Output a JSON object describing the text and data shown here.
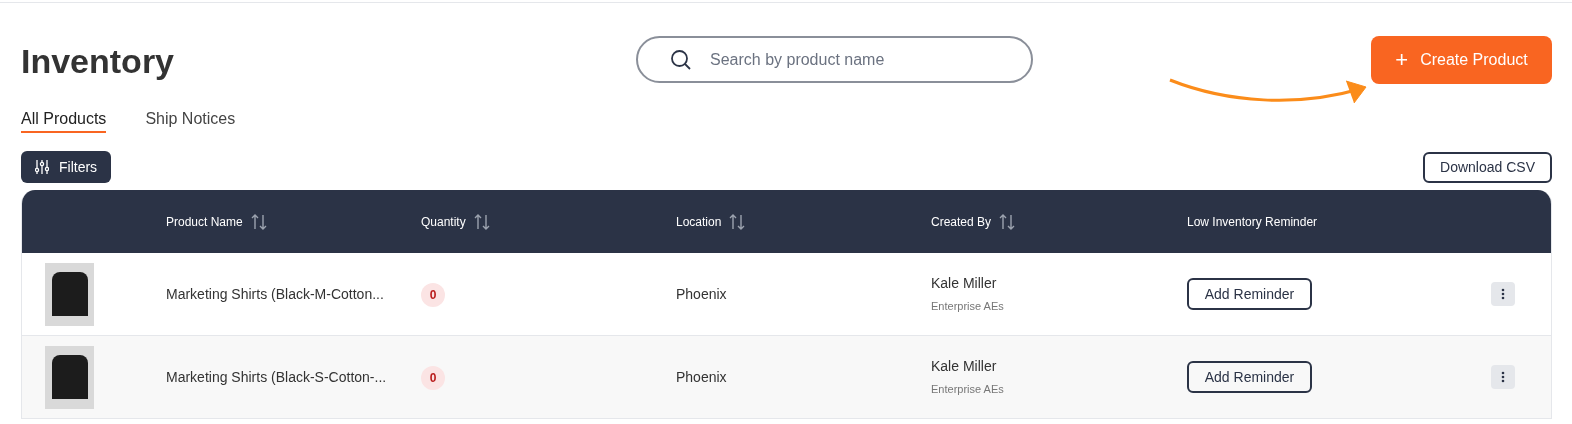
{
  "page_title": "Inventory",
  "search": {
    "placeholder": "Search by product name"
  },
  "create_button": {
    "label": "Create Product",
    "icon": "+"
  },
  "tabs": [
    {
      "label": "All Products",
      "selected": true
    },
    {
      "label": "Ship Notices",
      "selected": false
    }
  ],
  "filters_button": {
    "label": "Filters"
  },
  "download_button": {
    "label": "Download CSV"
  },
  "table": {
    "columns": [
      {
        "label": "Product Name",
        "sortable": true
      },
      {
        "label": "Quantity",
        "sortable": true
      },
      {
        "label": "Location",
        "sortable": true
      },
      {
        "label": "Created By",
        "sortable": true
      },
      {
        "label": "Low Inventory Reminder",
        "sortable": false
      }
    ],
    "rows": [
      {
        "product_name": "Marketing Shirts (Black-M-Cotton...",
        "quantity": "0",
        "location": "Phoenix",
        "created_by": "Kale Miller",
        "team": "Enterprise AEs",
        "reminder_button": "Add Reminder"
      },
      {
        "product_name": "Marketing Shirts (Black-S-Cotton-...",
        "quantity": "0",
        "location": "Phoenix",
        "created_by": "Kale Miller",
        "team": "Enterprise AEs",
        "reminder_button": "Add Reminder"
      }
    ]
  }
}
